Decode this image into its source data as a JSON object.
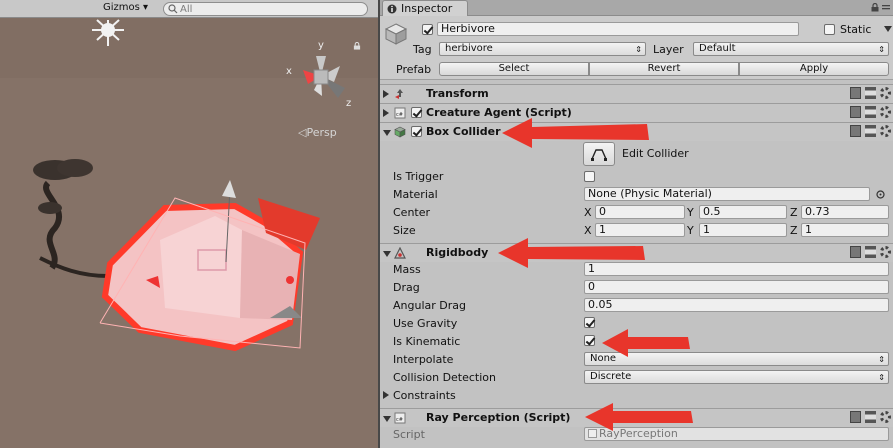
{
  "scene": {
    "gizmos_label": "Gizmos ▾",
    "search_placeholder": "All",
    "persp_label": "Persp",
    "axis_y": "y",
    "axis_x": "x",
    "axis_z": "z"
  },
  "inspector": {
    "tab_label": "Inspector",
    "object": {
      "active": true,
      "name": "Herbivore",
      "static_label": "Static",
      "static": false,
      "tag_label": "Tag",
      "tag_value": "herbivore",
      "layer_label": "Layer",
      "layer_value": "Default",
      "prefab_label": "Prefab",
      "select_label": "Select",
      "revert_label": "Revert",
      "apply_label": "Apply"
    },
    "components": {
      "transform": {
        "title": "Transform",
        "expanded": false
      },
      "creature_agent": {
        "title": "Creature Agent (Script)",
        "expanded": false,
        "enabled": true
      },
      "box_collider": {
        "title": "Box Collider",
        "expanded": true,
        "enabled": true,
        "edit_collider_label": "Edit Collider",
        "is_trigger_label": "Is Trigger",
        "is_trigger": false,
        "material_label": "Material",
        "material_value": "None (Physic Material)",
        "center_label": "Center",
        "center": {
          "x": "0",
          "y": "0.5",
          "z": "0.73"
        },
        "size_label": "Size",
        "size": {
          "x": "1",
          "y": "1",
          "z": "1"
        }
      },
      "rigidbody": {
        "title": "Rigidbody",
        "expanded": true,
        "mass_label": "Mass",
        "mass": "1",
        "drag_label": "Drag",
        "drag": "0",
        "angular_drag_label": "Angular Drag",
        "angular_drag": "0.05",
        "use_gravity_label": "Use Gravity",
        "use_gravity": true,
        "is_kinematic_label": "Is Kinematic",
        "is_kinematic": true,
        "interpolate_label": "Interpolate",
        "interpolate_value": "None",
        "collision_detection_label": "Collision Detection",
        "collision_detection_value": "Discrete",
        "constraints_label": "Constraints"
      },
      "ray_perception": {
        "title": "Ray Perception (Script)",
        "expanded": true,
        "script_label": "Script",
        "script_value": "RayPerception"
      }
    },
    "vector_axes": {
      "x": "X",
      "y": "Y",
      "z": "Z"
    }
  },
  "colors": {
    "annotation_arrow": "#e8352b",
    "inspector_bg": "#c2c2c2",
    "selection_outline": "#ff3a2a"
  }
}
